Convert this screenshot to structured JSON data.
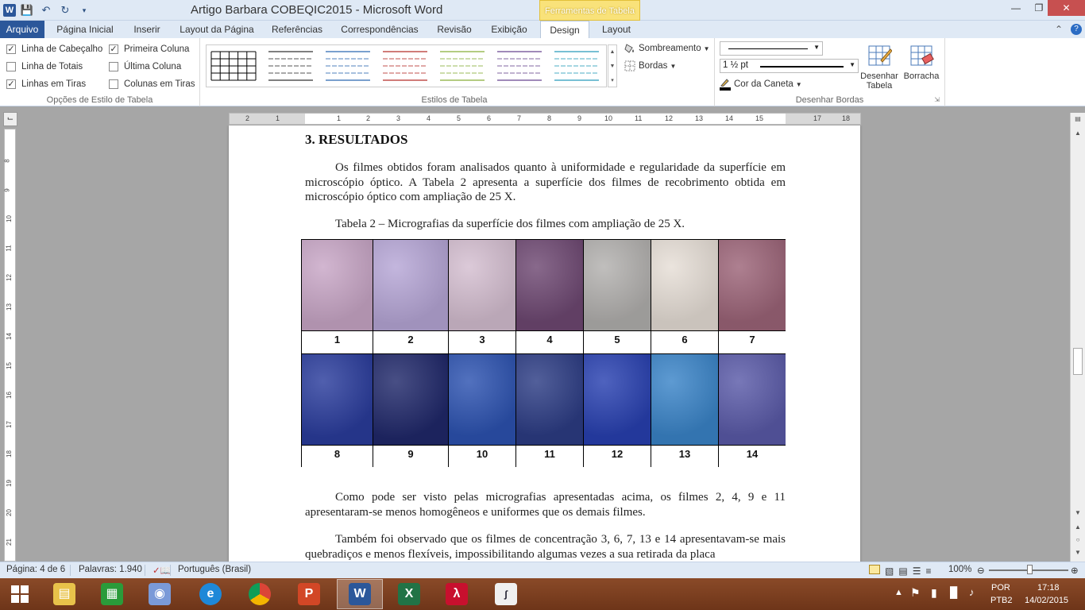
{
  "window": {
    "title": "Artigo Barbara COBEQIC2015  -  Microsoft Word",
    "contextual_tab_header": "Ferramentas de Tabela"
  },
  "ribbon_tabs": [
    {
      "label": "Arquivo"
    },
    {
      "label": "Página Inicial"
    },
    {
      "label": "Inserir"
    },
    {
      "label": "Layout da Página"
    },
    {
      "label": "Referências"
    },
    {
      "label": "Correspondências"
    },
    {
      "label": "Revisão"
    },
    {
      "label": "Exibição"
    },
    {
      "label": "Design"
    },
    {
      "label": "Layout"
    }
  ],
  "ribbon": {
    "table_style_options": {
      "group_label": "Opções de Estilo de Tabela",
      "options": [
        {
          "label": "Linha de Cabeçalho",
          "checked": true
        },
        {
          "label": "Linha de Totais",
          "checked": false
        },
        {
          "label": "Linhas em Tiras",
          "checked": true
        },
        {
          "label": "Primeira Coluna",
          "checked": true
        },
        {
          "label": "Última Coluna",
          "checked": false
        },
        {
          "label": "Colunas em Tiras",
          "checked": false
        }
      ]
    },
    "table_styles": {
      "group_label": "Estilos de Tabela",
      "shading_label": "Sombreamento",
      "borders_label": "Bordas",
      "style_colors": [
        "#000000",
        "#555555",
        "#4f81bd",
        "#c0504d",
        "#9bbb59",
        "#8064a2",
        "#4bacc6"
      ]
    },
    "draw_borders": {
      "group_label": "Desenhar Bordas",
      "pen_weight": "1 ½ pt",
      "pen_color_label": "Cor da Caneta",
      "draw_table_label": "Desenhar Tabela",
      "eraser_label": "Borracha"
    }
  },
  "document": {
    "heading": "3. RESULTADOS",
    "paragraph1": "Os filmes obtidos foram analisados quanto à uniformidade e regularidade da superfície em microscópio óptico. A Tabela 2 apresenta a superfície dos filmes de recobrimento obtida em microscópio óptico com ampliação de 25 X.",
    "caption": "Tabela 2 – Micrografias da superfície dos filmes com ampliação de 25 X.",
    "table_labels_row1": [
      "1",
      "2",
      "3",
      "4",
      "5",
      "6",
      "7"
    ],
    "table_labels_row2": [
      "8",
      "9",
      "10",
      "11",
      "12",
      "13",
      "14"
    ],
    "micrograph_colors_row1": [
      "#c8a6c6",
      "#b6a6d6",
      "#d4bed0",
      "#6e4872",
      "#b2b0ae",
      "#e6ded6",
      "#9c6478"
    ],
    "micrograph_colors_row2": [
      "#2a3c9c",
      "#20286a",
      "#2c52b0",
      "#2c3c84",
      "#2840b0",
      "#3a84c8",
      "#5a5aa8"
    ],
    "paragraph2": "Como pode ser visto pelas micrografias apresentadas acima, os filmes 2, 4, 9 e 11 apresentaram-se menos homogêneos e uniformes que os demais filmes.",
    "paragraph3": "Também foi observado que os filmes de concentração 3, 6, 7, 13 e 14 apresentavam-se mais quebradiços e menos flexíveis, impossibilitando algumas vezes a sua retirada da placa"
  },
  "statusbar": {
    "page": "Página: 4 de 6",
    "words": "Palavras: 1.940",
    "language": "Português (Brasil)",
    "zoom": "100%"
  },
  "taskbar": {
    "lang_top": "POR",
    "lang_bottom": "PTB2",
    "time": "17:18",
    "date": "14/02/2015"
  }
}
